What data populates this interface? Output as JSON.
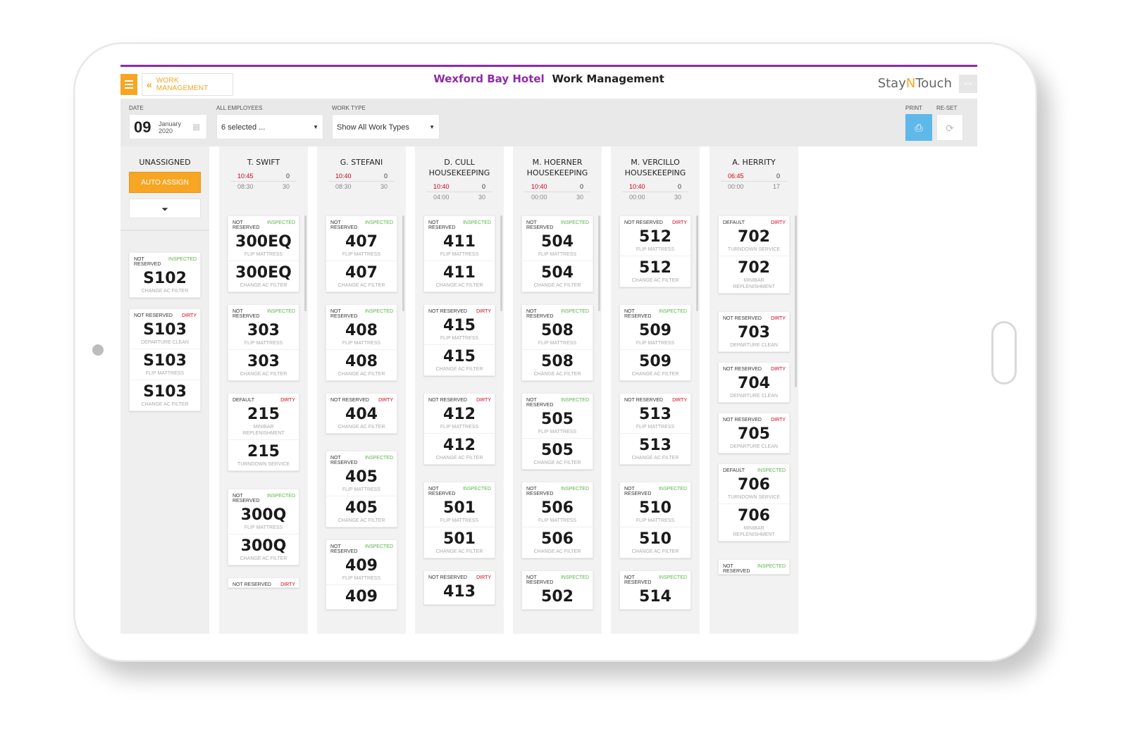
{
  "header": {
    "back_label": "WORK MANAGEMENT",
    "hotel_name": "Wexford Bay Hotel",
    "page_title": "Work Management",
    "brand_a": "Stay",
    "brand_n": "N",
    "brand_b": "Touch"
  },
  "filters": {
    "date_label": "DATE",
    "date_day": "09",
    "date_month": "January",
    "date_year": "2020",
    "employees_label": "ALL EMPLOYEES",
    "employees_value": "6 selected ...",
    "worktype_label": "WORK TYPE",
    "worktype_value": "Show All Work Types",
    "print_label": "PRINT",
    "reset_label": "RE-SET"
  },
  "unassigned": {
    "title": "UNASSIGNED",
    "auto_assign": "AUTO ASSIGN",
    "filter_icon": "funnel-icon",
    "cards": [
      {
        "status": "NOT RESERVED",
        "state": "INSPECTED",
        "state_type": "insp",
        "tasks": [
          {
            "room": "S102",
            "type": "CHANGE AC FILTER"
          }
        ]
      },
      {
        "status": "NOT RESERVED",
        "state": "DIRTY",
        "state_type": "dirty",
        "tasks": [
          {
            "room": "S103",
            "type": "DEPARTURE CLEAN"
          },
          {
            "room": "S103",
            "type": "FLIP MATTRESS"
          },
          {
            "room": "S103",
            "type": "CHANGE AC FILTER"
          }
        ]
      }
    ]
  },
  "employees": [
    {
      "name": "T. SWIFT",
      "name2": "",
      "time": "10:45",
      "time2": "08:30",
      "count": "0",
      "count2": "30",
      "cards": [
        {
          "status": "NOT RESERVED",
          "state": "INSPECTED",
          "state_type": "insp",
          "tasks": [
            {
              "room": "300EQ",
              "type": "FLIP MATTRESS"
            },
            {
              "room": "300EQ",
              "type": "CHANGE AC FILTER"
            }
          ]
        },
        {
          "status": "NOT RESERVED",
          "state": "INSPECTED",
          "state_type": "insp",
          "tasks": [
            {
              "room": "303",
              "type": "FLIP MATTRESS"
            },
            {
              "room": "303",
              "type": "CHANGE AC FILTER"
            }
          ]
        },
        {
          "status": "DEFAULT",
          "state": "DIRTY",
          "state_type": "dirty",
          "tasks": [
            {
              "room": "215",
              "type": "MINIBAR REPLENISHMENT"
            },
            {
              "room": "215",
              "type": "TURNDOWN SERVICE"
            }
          ]
        },
        {
          "status": "NOT RESERVED",
          "state": "INSPECTED",
          "state_type": "insp",
          "tasks": [
            {
              "room": "300Q",
              "type": "FLIP MATTRESS"
            },
            {
              "room": "300Q",
              "type": "CHANGE AC FILTER"
            }
          ]
        },
        {
          "status": "NOT RESERVED",
          "state": "DIRTY",
          "state_type": "dirty",
          "tasks": []
        }
      ]
    },
    {
      "name": "G. STEFANI",
      "name2": "",
      "time": "10:40",
      "time2": "08:30",
      "count": "0",
      "count2": "30",
      "cards": [
        {
          "status": "NOT RESERVED",
          "state": "INSPECTED",
          "state_type": "insp",
          "tasks": [
            {
              "room": "407",
              "type": "FLIP MATTRESS"
            },
            {
              "room": "407",
              "type": "CHANGE AC FILTER"
            }
          ]
        },
        {
          "status": "NOT RESERVED",
          "state": "INSPECTED",
          "state_type": "insp",
          "tasks": [
            {
              "room": "408",
              "type": "FLIP MATTRESS"
            },
            {
              "room": "408",
              "type": "CHANGE AC FILTER"
            }
          ]
        },
        {
          "status": "NOT RESERVED",
          "state": "DIRTY",
          "state_type": "dirty",
          "tasks": [
            {
              "room": "404",
              "type": "CHANGE AC FILTER"
            }
          ]
        },
        {
          "status": "NOT RESERVED",
          "state": "INSPECTED",
          "state_type": "insp",
          "tasks": [
            {
              "room": "405",
              "type": "FLIP MATTRESS"
            },
            {
              "room": "405",
              "type": "CHANGE AC FILTER"
            }
          ]
        },
        {
          "status": "NOT RESERVED",
          "state": "INSPECTED",
          "state_type": "insp",
          "tasks": [
            {
              "room": "409",
              "type": "FLIP MATTRESS"
            },
            {
              "room": "409",
              "type": ""
            }
          ]
        }
      ]
    },
    {
      "name": "D. CULL",
      "name2": "HOUSEKEEPING",
      "time": "10:40",
      "time2": "04:00",
      "count": "0",
      "count2": "30",
      "cards": [
        {
          "status": "NOT RESERVED",
          "state": "INSPECTED",
          "state_type": "insp",
          "tasks": [
            {
              "room": "411",
              "type": "FLIP MATTRESS"
            },
            {
              "room": "411",
              "type": "CHANGE AC FILTER"
            }
          ]
        },
        {
          "status": "NOT RESERVED",
          "state": "DIRTY",
          "state_type": "dirty",
          "tasks": [
            {
              "room": "415",
              "type": "FLIP MATTRESS"
            },
            {
              "room": "415",
              "type": "CHANGE AC FILTER"
            }
          ]
        },
        {
          "status": "NOT RESERVED",
          "state": "DIRTY",
          "state_type": "dirty",
          "tasks": [
            {
              "room": "412",
              "type": "FLIP MATTRESS"
            },
            {
              "room": "412",
              "type": "CHANGE AC FILTER"
            }
          ]
        },
        {
          "status": "NOT RESERVED",
          "state": "INSPECTED",
          "state_type": "insp",
          "tasks": [
            {
              "room": "501",
              "type": "FLIP MATTRESS"
            },
            {
              "room": "501",
              "type": "CHANGE AC FILTER"
            }
          ]
        },
        {
          "status": "NOT RESERVED",
          "state": "DIRTY",
          "state_type": "dirty",
          "tasks": [
            {
              "room": "413",
              "type": ""
            }
          ]
        }
      ]
    },
    {
      "name": "M. HOERNER",
      "name2": "HOUSEKEEPING",
      "time": "10:40",
      "time2": "00:00",
      "count": "0",
      "count2": "30",
      "cards": [
        {
          "status": "NOT RESERVED",
          "state": "INSPECTED",
          "state_type": "insp",
          "tasks": [
            {
              "room": "504",
              "type": "FLIP MATTRESS"
            },
            {
              "room": "504",
              "type": "CHANGE AC FILTER"
            }
          ]
        },
        {
          "status": "NOT RESERVED",
          "state": "INSPECTED",
          "state_type": "insp",
          "tasks": [
            {
              "room": "508",
              "type": "FLIP MATTRESS"
            },
            {
              "room": "508",
              "type": "CHANGE AC FILTER"
            }
          ]
        },
        {
          "status": "NOT RESERVED",
          "state": "INSPECTED",
          "state_type": "insp",
          "tasks": [
            {
              "room": "505",
              "type": "FLIP MATTRESS"
            },
            {
              "room": "505",
              "type": "CHANGE AC FILTER"
            }
          ]
        },
        {
          "status": "NOT RESERVED",
          "state": "INSPECTED",
          "state_type": "insp",
          "tasks": [
            {
              "room": "506",
              "type": "FLIP MATTRESS"
            },
            {
              "room": "506",
              "type": "CHANGE AC FILTER"
            }
          ]
        },
        {
          "status": "NOT RESERVED",
          "state": "INSPECTED",
          "state_type": "insp",
          "tasks": [
            {
              "room": "502",
              "type": ""
            }
          ]
        }
      ]
    },
    {
      "name": "M. VERCILLO",
      "name2": "HOUSEKEEPING",
      "time": "10:40",
      "time2": "00:00",
      "count": "0",
      "count2": "30",
      "cards": [
        {
          "status": "NOT RESERVED",
          "state": "DIRTY",
          "state_type": "dirty",
          "tasks": [
            {
              "room": "512",
              "type": "FLIP MATTRESS"
            },
            {
              "room": "512",
              "type": "CHANGE AC FILTER"
            }
          ]
        },
        {
          "status": "NOT RESERVED",
          "state": "INSPECTED",
          "state_type": "insp",
          "tasks": [
            {
              "room": "509",
              "type": "FLIP MATTRESS"
            },
            {
              "room": "509",
              "type": "CHANGE AC FILTER"
            }
          ]
        },
        {
          "status": "NOT RESERVED",
          "state": "DIRTY",
          "state_type": "dirty",
          "tasks": [
            {
              "room": "513",
              "type": "FLIP MATTRESS"
            },
            {
              "room": "513",
              "type": "CHANGE AC FILTER"
            }
          ]
        },
        {
          "status": "NOT RESERVED",
          "state": "INSPECTED",
          "state_type": "insp",
          "tasks": [
            {
              "room": "510",
              "type": "FLIP MATTRESS"
            },
            {
              "room": "510",
              "type": "CHANGE AC FILTER"
            }
          ]
        },
        {
          "status": "NOT RESERVED",
          "state": "INSPECTED",
          "state_type": "insp",
          "tasks": [
            {
              "room": "514",
              "type": ""
            }
          ]
        }
      ]
    },
    {
      "name": "A. HERRITY",
      "name2": "",
      "time": "06:45",
      "time2": "00:00",
      "count": "0",
      "count2": "17",
      "cards": [
        {
          "status": "DEFAULT",
          "state": "DIRTY",
          "state_type": "dirty",
          "tasks": [
            {
              "room": "702",
              "type": "TURNDOWN SERVICE"
            },
            {
              "room": "702",
              "type": "MINIBAR REPLENISHMENT"
            }
          ]
        },
        {
          "status": "NOT RESERVED",
          "state": "DIRTY",
          "state_type": "dirty",
          "tasks": [
            {
              "room": "703",
              "type": "DEPARTURE CLEAN"
            }
          ]
        },
        {
          "status": "NOT RESERVED",
          "state": "DIRTY",
          "state_type": "dirty",
          "tasks": [
            {
              "room": "704",
              "type": "DEPARTURE CLEAN"
            }
          ]
        },
        {
          "status": "NOT RESERVED",
          "state": "DIRTY",
          "state_type": "dirty",
          "tasks": [
            {
              "room": "705",
              "type": "DEPARTURE CLEAN"
            }
          ]
        },
        {
          "status": "DEFAULT",
          "state": "INSPECTED",
          "state_type": "insp",
          "tasks": [
            {
              "room": "706",
              "type": "TURNDOWN SERVICE"
            },
            {
              "room": "706",
              "type": "MINIBAR REPLENISHMENT"
            }
          ]
        },
        {
          "status": "NOT RESERVED",
          "state": "INSPECTED",
          "state_type": "insp",
          "tasks": []
        }
      ]
    }
  ]
}
